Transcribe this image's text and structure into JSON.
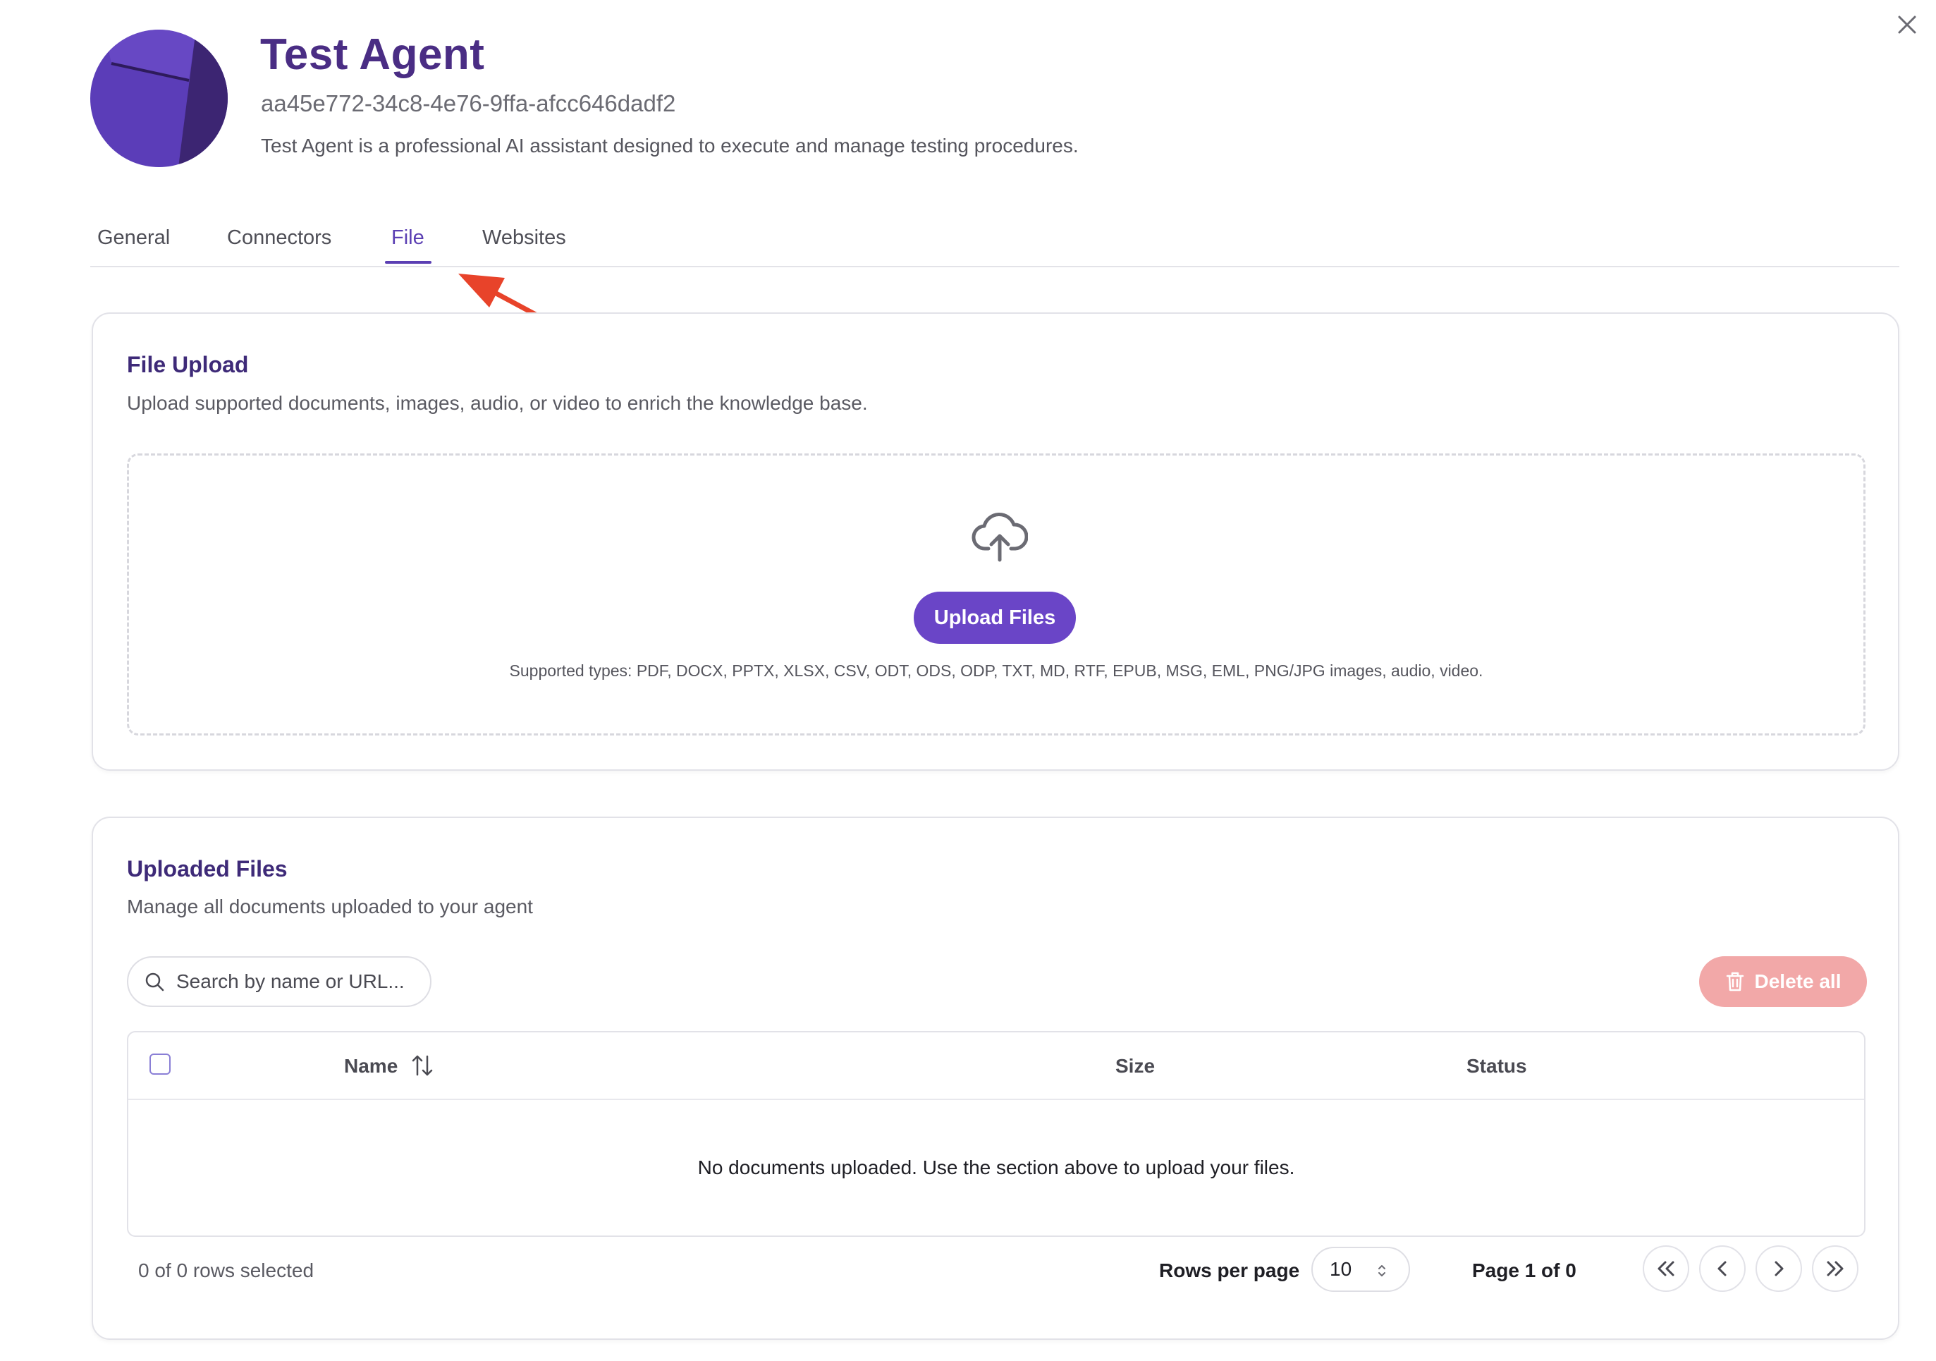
{
  "agent": {
    "name": "Test Agent",
    "id": "aa45e772-34c8-4e76-9ffa-afcc646dadf2",
    "description": "Test Agent is a professional AI assistant designed to execute and manage testing procedures."
  },
  "tabs": [
    {
      "label": "General",
      "active": false
    },
    {
      "label": "Connectors",
      "active": false
    },
    {
      "label": "File",
      "active": true
    },
    {
      "label": "Websites",
      "active": false
    }
  ],
  "upload_section": {
    "title": "File Upload",
    "subtitle": "Upload supported documents, images, audio, or video to enrich the knowledge base.",
    "button_label": "Upload Files",
    "supported_types": "Supported types: PDF, DOCX, PPTX, XLSX, CSV, ODT, ODS, ODP, TXT, MD, RTF, EPUB, MSG, EML, PNG/JPG images, audio, video."
  },
  "files_section": {
    "title": "Uploaded Files",
    "subtitle": "Manage all documents uploaded to your agent",
    "search_placeholder": "Search by name or URL...",
    "delete_all_label": "Delete all",
    "columns": [
      "Name",
      "Size",
      "Status"
    ],
    "empty_message": "No documents uploaded. Use the section above to upload your files.",
    "selection_text": "0 of 0 rows selected",
    "rows_per_page_label": "Rows per page",
    "rows_per_page_value": "10",
    "page_text": "Page 1 of 0"
  },
  "icons": {
    "close": "close-icon",
    "upload": "cloud-upload-icon",
    "search": "search-icon",
    "delete": "trash-icon",
    "sort": "sort-icon",
    "first_page": "chevrons-left-icon",
    "prev_page": "chevron-left-icon",
    "next_page": "chevron-right-icon",
    "last_page": "chevrons-right-icon"
  },
  "colors": {
    "accent": "#6a45c7",
    "title": "#4a2d84",
    "delete": "#f2a8a8",
    "annotation_arrow": "#e8432a"
  }
}
